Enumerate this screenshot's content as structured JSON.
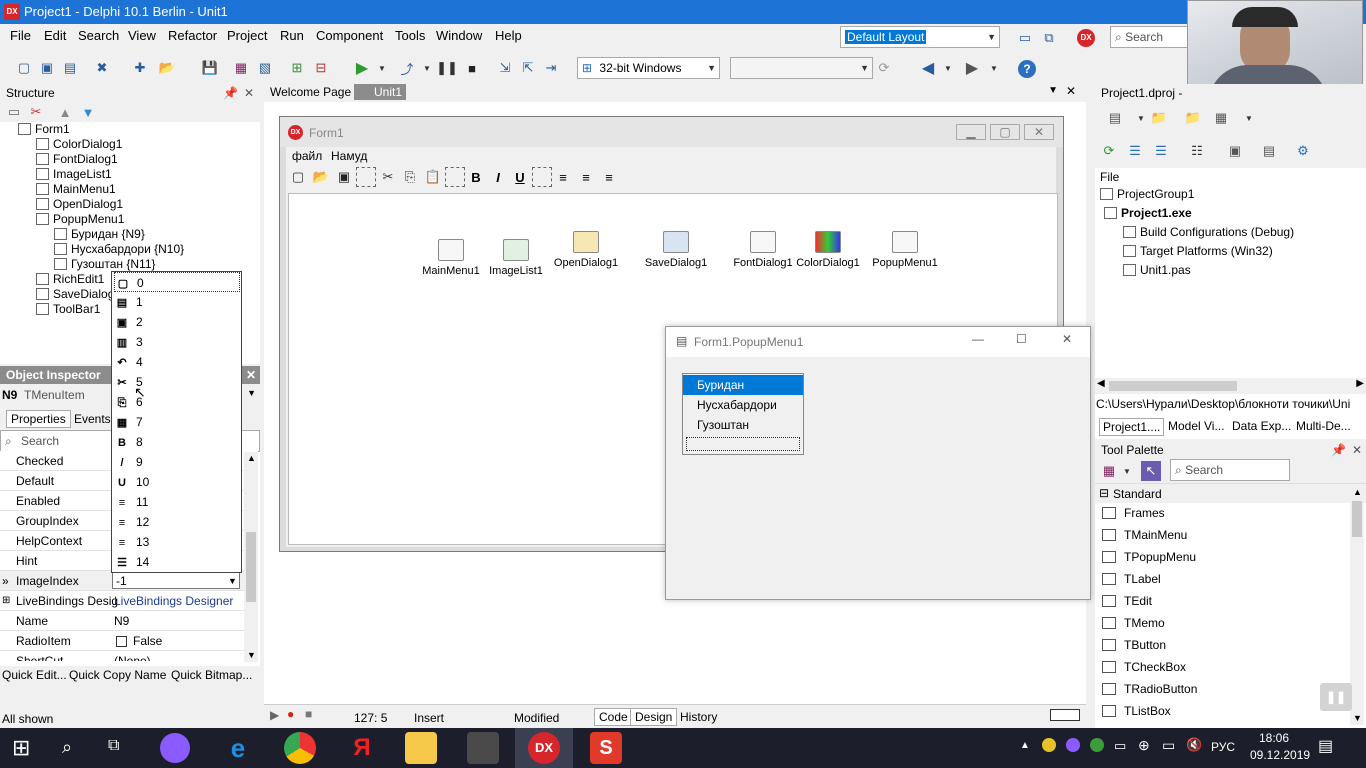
{
  "window": {
    "title": "Project1 - Delphi 10.1 Berlin - Unit1",
    "app_icon": "DX"
  },
  "menu": [
    "File",
    "Edit",
    "Search",
    "View",
    "Refactor",
    "Project",
    "Run",
    "Component",
    "Tools",
    "Window",
    "Help"
  ],
  "layout_combo": "Default Layout",
  "platform_combo": "32-bit Windows",
  "search_placeholder": "Search",
  "structure": {
    "title": "Structure",
    "tree": [
      "Form1",
      "ColorDialog1",
      "FontDialog1",
      "ImageList1",
      "MainMenu1",
      "OpenDialog1",
      "PopupMenu1",
      "Буридан {N9}",
      "Нусхабардори {N10}",
      "Гузоштан {N11}",
      "RichEdit1",
      "SaveDialog",
      "ToolBar1"
    ]
  },
  "editor_tabs": [
    "Welcome Page",
    "Unit1"
  ],
  "form1": {
    "title": "Form1",
    "menu": [
      "файл",
      "Намуд"
    ],
    "components": [
      "MainMenu1",
      "ImageList1",
      "OpenDialog1",
      "SaveDialog1",
      "FontDialog1",
      "ColorDialog1",
      "PopupMenu1"
    ]
  },
  "image_index_dropdown": [
    "0",
    "1",
    "2",
    "3",
    "4",
    "5",
    "6",
    "7",
    "8",
    "9",
    "10",
    "11",
    "12",
    "13",
    "14"
  ],
  "object_inspector": {
    "title": "Object Inspector",
    "selected": "N9",
    "selected_type": "TMenuItem",
    "tabs": [
      "Properties",
      "Events"
    ],
    "search_placeholder": "Search",
    "rows": [
      {
        "key": "Checked",
        "value": ""
      },
      {
        "key": "Default",
        "value": ""
      },
      {
        "key": "Enabled",
        "value": ""
      },
      {
        "key": "GroupIndex",
        "value": ""
      },
      {
        "key": "HelpContext",
        "value": ""
      },
      {
        "key": "Hint",
        "value": ""
      },
      {
        "key": "ImageIndex",
        "value": "-1"
      },
      {
        "key": "LiveBindings Desig",
        "value": "LiveBindings Designer"
      },
      {
        "key": "Name",
        "value": "N9"
      },
      {
        "key": "RadioItem",
        "value": "False"
      },
      {
        "key": "ShortCut",
        "value": "(None)"
      }
    ],
    "quick_links": [
      "Quick Edit...",
      "Quick Copy Name",
      "Quick Bitmap..."
    ],
    "status": "All shown"
  },
  "popup_designer": {
    "title": "Form1.PopupMenu1",
    "items": [
      "Буридан",
      "Нусхабардори",
      "Гузоштан"
    ]
  },
  "project_manager": {
    "title": "Project1.dproj - ",
    "file_label": "File",
    "tree": [
      "ProjectGroup1",
      "Project1.exe",
      "Build Configurations (Debug)",
      "Target Platforms (Win32)",
      "Unit1.pas"
    ],
    "path": "C:\\Users\\Нурали\\Desktop\\блокноти точики\\Uni",
    "tabs": [
      "Project1....",
      "Model Vi...",
      "Data Exp...",
      "Multi-De..."
    ]
  },
  "tool_palette": {
    "title": "Tool Palette",
    "search_placeholder": "Search",
    "category": "Standard",
    "items": [
      "Frames",
      "TMainMenu",
      "TPopupMenu",
      "TLabel",
      "TEdit",
      "TMemo",
      "TButton",
      "TCheckBox",
      "TRadioButton",
      "TListBox"
    ]
  },
  "statusbar": {
    "position": "127:  5",
    "mode": "Insert",
    "state": "Modified",
    "tabs": [
      "Code",
      "Design",
      "History"
    ]
  },
  "tray": {
    "lang": "РУС",
    "time": "18:06",
    "date": "09.12.2019"
  },
  "colors": {
    "titlebar": "#1e74d6",
    "selection": "#0078d7",
    "taskbar": "#1c1f2b",
    "dx_red": "#d7262b"
  }
}
